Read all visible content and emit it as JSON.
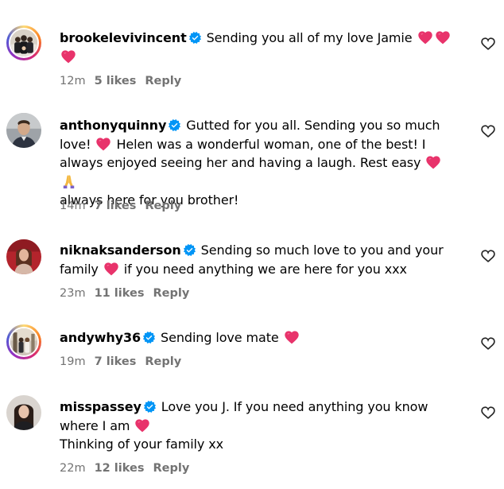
{
  "comments": [
    {
      "username": "brookelevivincent",
      "text_parts": [
        "Sending you all of my love Jamie",
        "",
        ""
      ],
      "time": "12m",
      "likes": "5 likes",
      "reply": "Reply"
    },
    {
      "username": "anthonyquinny",
      "line1": "Gutted for you all. Sending you so much",
      "line2a": "love!",
      "line2b": "Helen was a wonderful woman, one of the best! I",
      "line3": "always enjoyed seeing her and having a laugh. Rest easy",
      "line4": "always here for you brother!",
      "time": "14m",
      "likes": "7 likes",
      "reply": "Reply"
    },
    {
      "username": "niknaksanderson",
      "line1": "Sending so much love to you and your",
      "line2a": "family",
      "line2b": "if you need anything we are here for you xxx",
      "time": "23m",
      "likes": "11 likes",
      "reply": "Reply"
    },
    {
      "username": "andywhy36",
      "line1": "Sending love mate",
      "time": "19m",
      "likes": "7 likes",
      "reply": "Reply"
    },
    {
      "username": "misspassey",
      "line1": "Love you J. If you need anything you know",
      "line2": "where I am",
      "line3": "Thinking of your family xx",
      "time": "22m",
      "likes": "12 likes",
      "reply": "Reply"
    }
  ],
  "icons": {
    "verified": "verified-badge-icon",
    "heart_emoji": "heart-emoji-icon",
    "pray_emoji": "folded-hands-emoji-icon",
    "like": "heart-outline-icon"
  },
  "colors": {
    "verified": "#0095f6",
    "heart": "#e8336b",
    "meta": "#737373"
  }
}
